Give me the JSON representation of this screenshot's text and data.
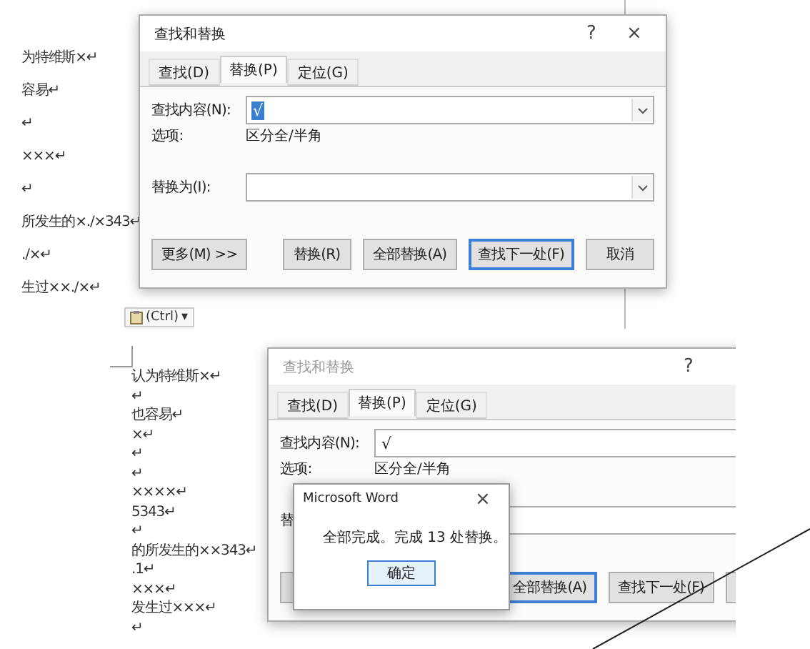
{
  "top": {
    "document_lines": [
      "为特维斯×↵",
      "容易↵",
      "↵",
      "×××↵",
      "↵",
      "所发生的×./×343↵",
      "./×↵",
      "生过××./×↵"
    ],
    "paste_button": {
      "label": "(Ctrl)",
      "caret": "▾"
    },
    "dialog": {
      "title": "查找和替换",
      "active": true,
      "help": "?",
      "close": "×",
      "tabs": [
        {
          "label": "查找(D)",
          "selected": false
        },
        {
          "label": "替换(P)",
          "selected": true
        },
        {
          "label": "定位(G)",
          "selected": false
        }
      ],
      "find_label": "查找内容(N):",
      "find_value": "√",
      "find_value_selected": true,
      "options_label": "选项:",
      "options_value": "区分全/半角",
      "replace_label": "替换为(I):",
      "buttons": [
        {
          "kind": "more",
          "label": "更多(M) >>",
          "focused": false
        },
        {
          "kind": "action",
          "label": "替换(R)",
          "focused": false
        },
        {
          "kind": "action",
          "label": "全部替换(A)",
          "focused": false
        },
        {
          "kind": "action",
          "label": "查找下一处(F)",
          "focused": true
        },
        {
          "kind": "action",
          "label": "取消",
          "focused": false
        }
      ]
    }
  },
  "bottom": {
    "document_lines": [
      "认为特维斯×↵",
      "↵",
      "也容易↵",
      "×↵",
      "↵",
      "↵",
      "××××↵",
      "5343↵",
      "↵",
      "的所发生的××343↵",
      ".1↵",
      "×××↵",
      "发生过×××↵",
      "↵"
    ],
    "dialog": {
      "title": "查找和替换",
      "active": false,
      "help": "?",
      "tabs": [
        {
          "label": "查找(D)",
          "selected": false
        },
        {
          "label": "替换(P)",
          "selected": true
        },
        {
          "label": "定位(G)",
          "selected": false
        }
      ],
      "find_label": "查找内容(N):",
      "find_value": "√",
      "find_value_selected": false,
      "options_label": "选项:",
      "options_value": "区分全/半角",
      "replace_label": "替",
      "buttons": [
        {
          "kind": "more",
          "focused": false
        },
        {
          "kind": "action",
          "label": "全部替换(A)",
          "focused": true
        },
        {
          "kind": "action",
          "label": "查找下一处(F)",
          "focused": false
        },
        {
          "kind": "action",
          "focused": false
        }
      ]
    },
    "message_box": {
      "title": "Microsoft Word",
      "close": "×",
      "message": "全部完成。完成 13 处替换。",
      "button": "确定"
    }
  }
}
